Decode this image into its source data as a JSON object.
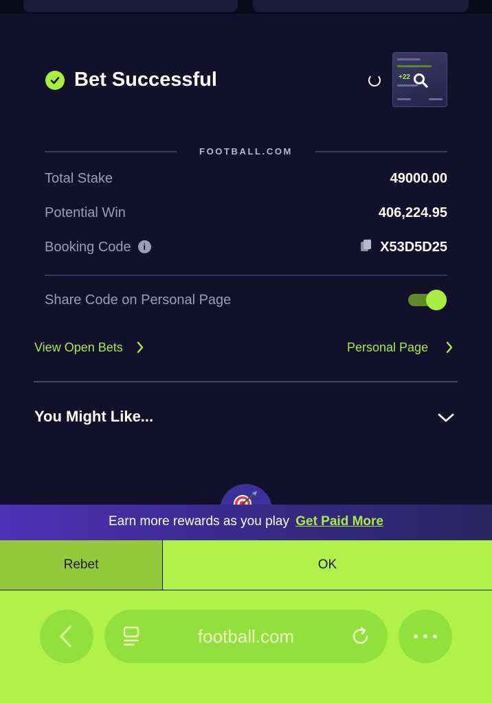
{
  "header": {
    "title": "Bet Successful"
  },
  "brand": {
    "left": "FOOTBALL",
    "dot": ".",
    "right": "COM"
  },
  "summary": {
    "total_stake_label": "Total Stake",
    "total_stake_value": "49000.00",
    "potential_win_label": "Potential Win",
    "potential_win_value": "406,224.95",
    "booking_code_label": "Booking Code",
    "booking_code_value": "X53D5D25"
  },
  "share": {
    "label": "Share Code on Personal Page",
    "enabled": true
  },
  "links": {
    "view_open_bets": "View Open Bets",
    "personal_page": "Personal Page"
  },
  "recommendations": {
    "title": "You Might Like..."
  },
  "promo": {
    "text": "Earn more rewards as you play",
    "link": "Get Paid More"
  },
  "actions": {
    "rebet": "Rebet",
    "ok": "OK"
  },
  "browser": {
    "url": "football.com"
  },
  "colors": {
    "accent": "#a8ee3f",
    "background": "#12102a",
    "browser_bar": "#b0f24a"
  }
}
